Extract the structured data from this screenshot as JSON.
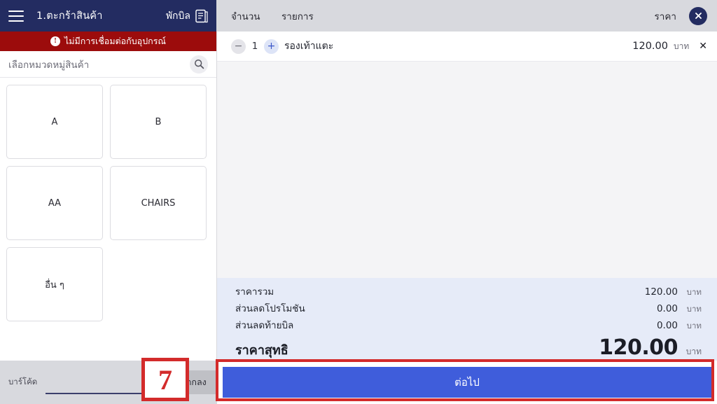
{
  "left": {
    "topbar": {
      "menu_icon": "hamburger-icon",
      "title": "1.ตะกร้าสินค้า",
      "hold_bill_label": "พักบิล",
      "hold_bill_icon": "receipt-icon"
    },
    "alert": {
      "icon": "exclamation-icon",
      "mark": "!",
      "message": "ไม่มีการเชื่อมต่อกับอุปกรณ์"
    },
    "search": {
      "placeholder": "เลือกหมวดหมู่สินค้า",
      "icon": "search-icon"
    },
    "categories": [
      {
        "label": "A"
      },
      {
        "label": "B"
      },
      {
        "label": "AA"
      },
      {
        "label": "CHAIRS"
      },
      {
        "label": "อื่น ๆ"
      }
    ],
    "barcode": {
      "label": "บาร์โค้ด",
      "value": "",
      "placeholder": "",
      "ok_label": "ตกลง"
    }
  },
  "right": {
    "header": {
      "qty": "จำนวน",
      "item": "รายการ",
      "price": "ราคา",
      "close_icon": "close-icon"
    },
    "rows": [
      {
        "minus": "−",
        "qty": "1",
        "plus": "+",
        "name": "รองเท้าแตะ",
        "price": "120.00",
        "unit": "บาท",
        "delete": "✕"
      }
    ],
    "summary": [
      {
        "label": "ราคารวม",
        "value": "120.00",
        "unit": "บาท"
      },
      {
        "label": "ส่วนลดโปรโมชัน",
        "value": "0.00",
        "unit": "บาท"
      },
      {
        "label": "ส่วนลดท้ายบิล",
        "value": "0.00",
        "unit": "บาท"
      }
    ],
    "total": {
      "label": "ราคาสุทธิ",
      "value": "120.00",
      "unit": "บาท"
    },
    "next_label": "ต่อไป"
  },
  "annotations": {
    "step_number": "7"
  },
  "colors": {
    "navy": "#232c61",
    "alert_red": "#9c0c0c",
    "accent_blue": "#3f5ddb",
    "summary_bg": "#e6ebf8",
    "annotation_red": "#d32b2b"
  }
}
